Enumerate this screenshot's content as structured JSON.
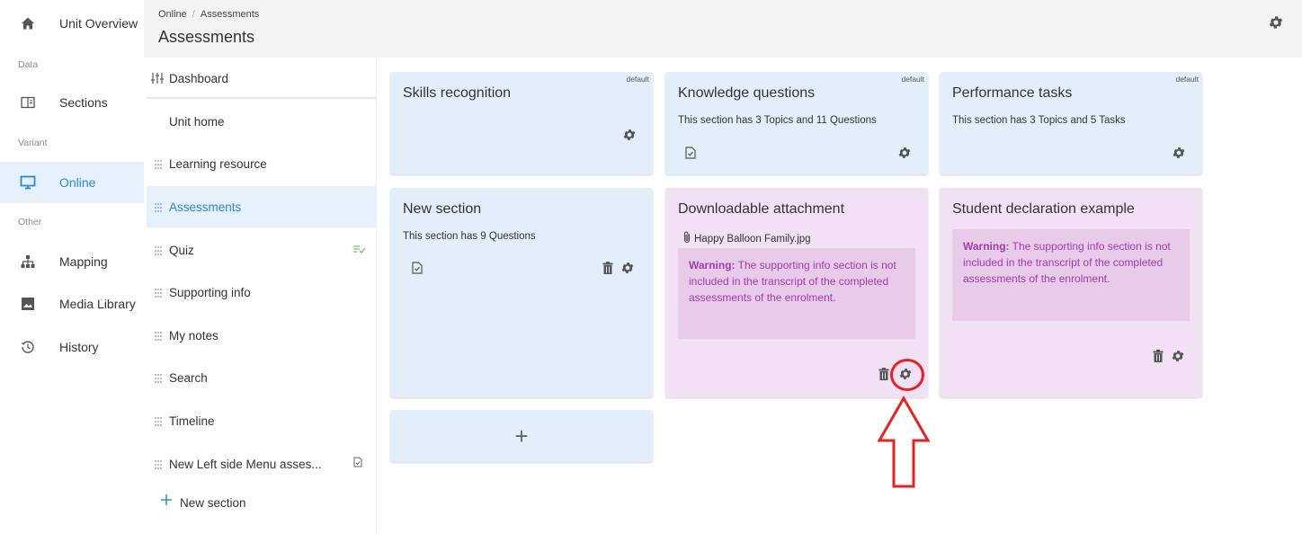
{
  "rail": {
    "unit_overview": "Unit Overview",
    "data_heading": "Data",
    "sections": "Sections",
    "variant_heading": "Variant",
    "online": "Online",
    "other_heading": "Other",
    "mapping": "Mapping",
    "media_library": "Media Library",
    "history": "History"
  },
  "header": {
    "breadcrumb": [
      "Online",
      "/",
      "Assessments"
    ],
    "title": "Assessments"
  },
  "submenu": {
    "items": [
      {
        "label": "Dashboard"
      },
      {
        "label": "Unit home"
      },
      {
        "label": "Learning resource"
      },
      {
        "label": "Assessments"
      },
      {
        "label": "Quiz"
      },
      {
        "label": "Supporting info"
      },
      {
        "label": "My notes"
      },
      {
        "label": "Search"
      },
      {
        "label": "Timeline"
      },
      {
        "label": "New Left side Menu asses..."
      }
    ],
    "new_section": "New section"
  },
  "cards": {
    "skills": {
      "title": "Skills recognition",
      "badge": "default"
    },
    "knowledge": {
      "title": "Knowledge questions",
      "badge": "default",
      "desc": "This section has 3 Topics and 11 Questions"
    },
    "performance": {
      "title": "Performance tasks",
      "badge": "default",
      "desc": "This section has 3 Topics and 5 Tasks"
    },
    "new_section": {
      "title": "New section",
      "desc": "This section has 9 Questions"
    },
    "downloadable": {
      "title": "Downloadable attachment",
      "attachment": "Happy Balloon Family.jpg",
      "warning_label": "Warning:",
      "warning_text": " The supporting info section is not included in the transcript of the completed assessments of the enrolment."
    },
    "student": {
      "title": "Student declaration example",
      "warning_label": "Warning:",
      "warning_text": " The supporting info section is not included in the transcript of the completed assessments of the enrolment."
    },
    "add_label": "+"
  },
  "colors": {
    "accent": "#2a8ad6",
    "card_blue": "#e2effa",
    "card_purple": "#f2e1f5",
    "warning_text": "#a13ab0",
    "annotation": "#e62222"
  }
}
